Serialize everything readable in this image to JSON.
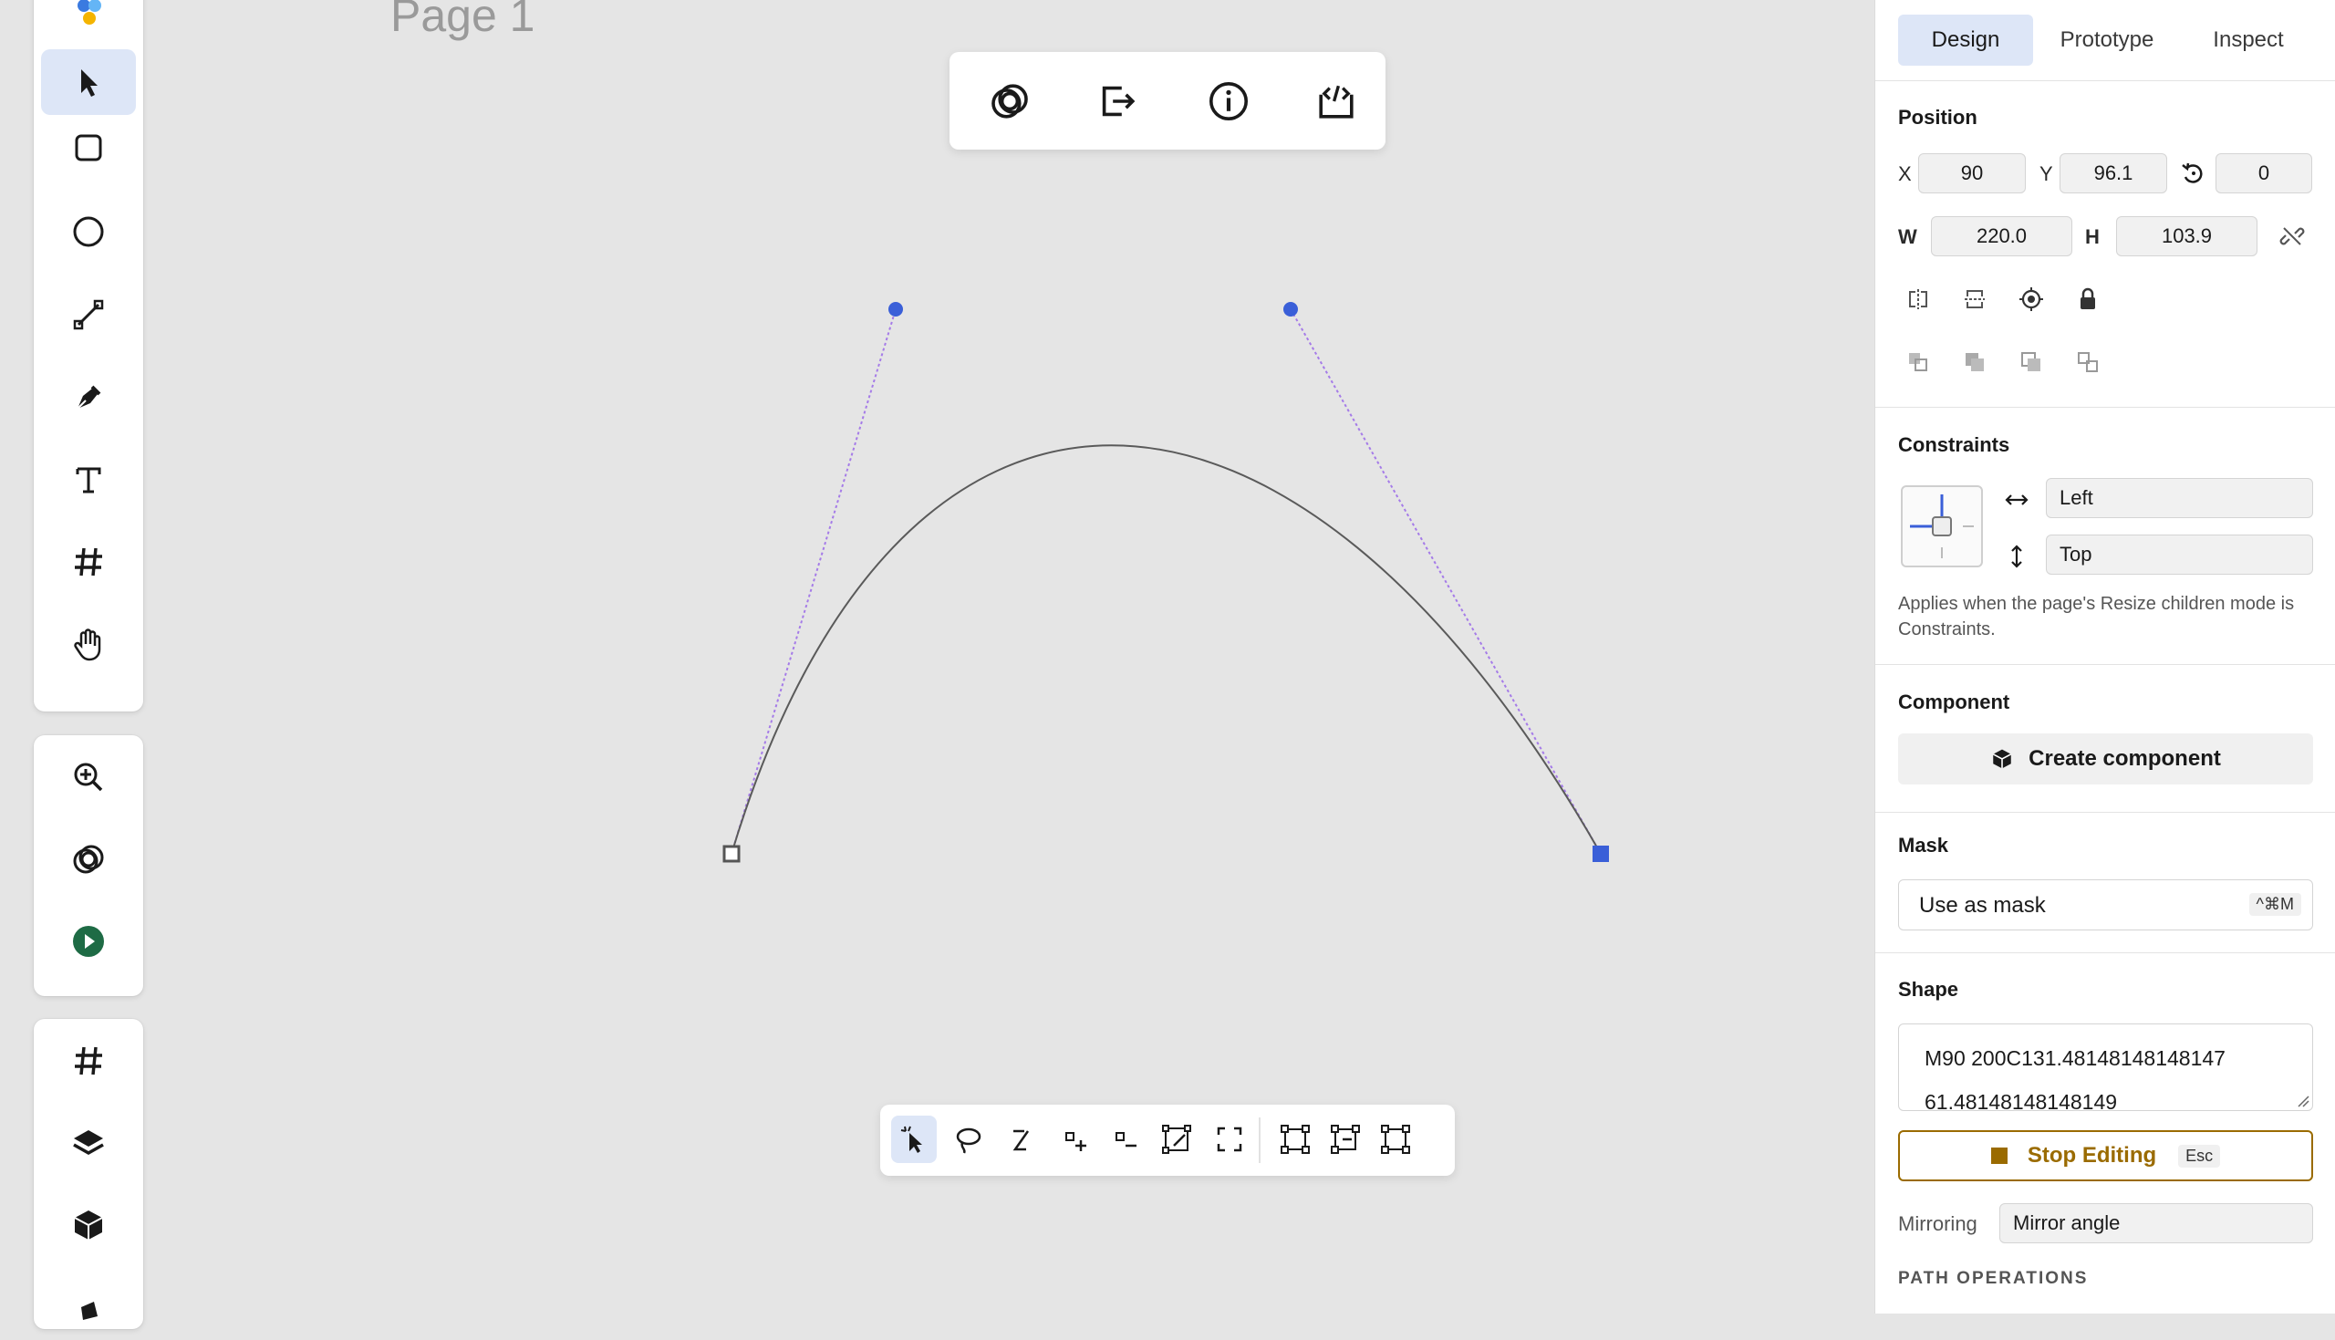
{
  "canvas": {
    "page_title": "Page 1"
  },
  "left_toolbar": {
    "tools": [
      "select-tool",
      "rectangle-tool",
      "ellipse-tool",
      "line-tool",
      "pen-tool",
      "text-tool",
      "frame-tool",
      "hand-tool"
    ],
    "secondary": [
      "zoom-tool",
      "boolean-tool",
      "play-button"
    ],
    "tertiary": [
      "frame-tool",
      "layers-tool",
      "component-tool"
    ]
  },
  "floating_toolbar": {
    "buttons": [
      "boolean-icon",
      "export-icon",
      "info-icon",
      "code-icon"
    ]
  },
  "path_toolbar": {
    "buttons": [
      "select-node-icon",
      "lasso-icon",
      "curve-icon",
      "add-node-icon",
      "remove-node-icon",
      "transform-icon",
      "close-path-icon",
      "align-left-icon",
      "align-center-icon",
      "align-right-icon"
    ]
  },
  "panel": {
    "tabs": [
      "Design",
      "Prototype",
      "Inspect"
    ],
    "active_tab": "Design",
    "position": {
      "title": "Position",
      "x_label": "X",
      "x": "90",
      "y_label": "Y",
      "y": "96.1",
      "rotation": "0",
      "w_label": "W",
      "w": "220.0",
      "h_label": "H",
      "h": "103.9"
    },
    "constraints": {
      "title": "Constraints",
      "horizontal": "Left",
      "vertical": "Top",
      "note": "Applies when the page's Resize children mode is Constraints."
    },
    "component": {
      "title": "Component",
      "button": "Create component"
    },
    "mask": {
      "title": "Mask",
      "button": "Use as mask",
      "shortcut": "^⌘M"
    },
    "shape": {
      "title": "Shape",
      "path_line1": "M90 200C131.48148148148147",
      "path_line2": "61.48148148148149",
      "stop_editing": "Stop Editing",
      "stop_shortcut": "Esc",
      "mirroring_label": "Mirroring",
      "mirroring_value": "Mirror angle",
      "path_ops_title": "PATH OPERATIONS"
    }
  },
  "colors": {
    "accent": "#3a5fd8",
    "canvas": "#e5e5e5",
    "stop_editing": "#9a6b00",
    "play": "#1e6b45"
  }
}
